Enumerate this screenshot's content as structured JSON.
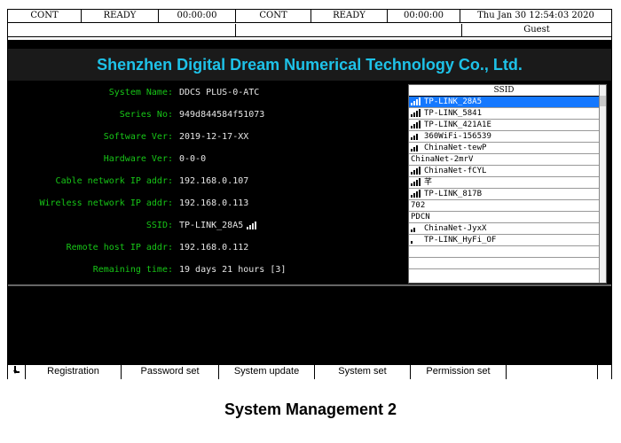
{
  "status_bar": {
    "cells": [
      "CONT",
      "READY",
      "00:00:00",
      "CONT",
      "READY",
      "00:00:00"
    ],
    "datetime": "Thu Jan 30 12:54:03 2020"
  },
  "user_bar": {
    "user": "Guest"
  },
  "title": "Shenzhen Digital Dream Numerical Technology Co., Ltd.",
  "info": [
    {
      "label": "System Name:",
      "value": "DDCS PLUS-0-ATC"
    },
    {
      "label": "Series No:",
      "value": "949d844584f51073"
    },
    {
      "label": "Software Ver:",
      "value": "2019-12-17-XX"
    },
    {
      "label": "Hardware Ver:",
      "value": "0-0-0"
    },
    {
      "label": "Cable network IP addr:",
      "value": "192.168.0.107"
    },
    {
      "label": "Wireless network IP addr:",
      "value": "192.168.0.113"
    },
    {
      "label": "SSID:",
      "value": "TP-LINK_28A5"
    },
    {
      "label": "Remote host IP addr:",
      "value": "192.168.0.112"
    },
    {
      "label": "Remaining time:",
      "value": "19 days 21 hours [3]"
    }
  ],
  "ssid_list": {
    "header": "SSID",
    "items": [
      {
        "name": "TP-LINK_28A5",
        "signal": 4,
        "selected": true
      },
      {
        "name": "TP-LINK_5841",
        "signal": 4,
        "selected": false
      },
      {
        "name": "TP-LINK_421A1E",
        "signal": 4,
        "selected": false
      },
      {
        "name": "360WiFi-156539",
        "signal": 3,
        "selected": false
      },
      {
        "name": "ChinaNet-tewP",
        "signal": 3,
        "selected": false
      },
      {
        "name": "ChinaNet-2mrV",
        "signal": 0,
        "selected": false
      },
      {
        "name": "ChinaNet-fCYL",
        "signal": 4,
        "selected": false
      },
      {
        "name": "芊",
        "signal": 4,
        "selected": false
      },
      {
        "name": "TP-LINK_817B",
        "signal": 4,
        "selected": false
      },
      {
        "name": "702",
        "signal": 0,
        "selected": false
      },
      {
        "name": "PDCN",
        "signal": 0,
        "selected": false
      },
      {
        "name": "ChinaNet-JyxX",
        "signal": 2,
        "selected": false
      },
      {
        "name": "TP-LINK_HyFi_OF",
        "signal": 1,
        "selected": false
      }
    ]
  },
  "buttons": [
    "Registration",
    "Password set",
    "System update",
    "System set",
    "Permission set"
  ],
  "caption": "System Management 2",
  "colors": {
    "panel_bg": "#000000",
    "title_text": "#1ec2e8",
    "label_text": "#17c617",
    "selected_row": "#1478ff"
  }
}
